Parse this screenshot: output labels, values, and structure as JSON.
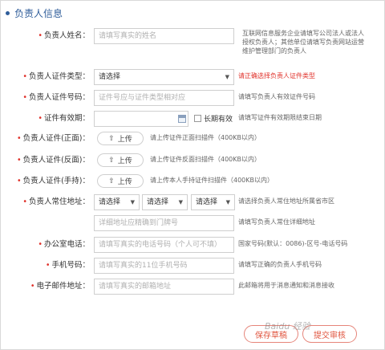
{
  "section": {
    "title": "负责人信息"
  },
  "fields": {
    "name": {
      "label": "负责人姓名：",
      "placeholder": "请填写真实的姓名",
      "hint": [
        "互联网信息服务企业请填写公司法人或法人",
        "授权负责人；其他单位请填写负责网站运营",
        "维护管理部门的负责人"
      ]
    },
    "id_type": {
      "label": "负责人证件类型：",
      "selected": "请选择",
      "hint": "请正确选择负责人证件类型"
    },
    "id_number": {
      "label": "负责人证件号码：",
      "placeholder": "证件号应与证件类型相对应",
      "hint": "请填写负责人有效证件号码"
    },
    "id_validity": {
      "label": "证件有效期：",
      "checkbox_label": "长期有效",
      "hint": "请填写证件有效期限结束日期"
    },
    "id_front": {
      "label": "负责人证件(正面)：",
      "button": "上传",
      "hint": "请上传证件正面扫描件（400KB以内）"
    },
    "id_back": {
      "label": "负责人证件(反面)：",
      "button": "上传",
      "hint": "请上传证件反面扫描件（400KB以内）"
    },
    "id_hand": {
      "label": "负责人证件(手持)：",
      "button": "上传",
      "hint": "请上传本人手持证件扫描件（400KB以内）"
    },
    "address": {
      "label": "负责人常住地址：",
      "select1": "请选择",
      "select2": "请选择",
      "select3": "请选择",
      "hint": "请选择负责人常住地址所属省市区",
      "detail_placeholder": "详细地址应精确到门牌号",
      "detail_hint": "请填写负责人常住详细地址"
    },
    "office_phone": {
      "label": "办公室电话：",
      "placeholder": "请填写真实的电话号码（个人可不填）",
      "hint": "国家号码(默认：0086)-区号-电话号码"
    },
    "mobile": {
      "label": "手机号码：",
      "placeholder": "请填写真实的11位手机号码",
      "hint": "请填写正确的负责人手机号码"
    },
    "email": {
      "label": "电子邮件地址：",
      "placeholder": "请填写真实的邮箱地址",
      "hint": "此邮箱将用于消息通知和消息接收"
    }
  },
  "required_mark": "•",
  "upload_icon": "upload-arrow-icon",
  "caret_icon": "▼",
  "actions": {
    "save": "保存草稿",
    "submit": "提交审核"
  },
  "watermark": "Baidu 经验",
  "colors": {
    "accent": "#2f5d9a",
    "required": "#e0322b",
    "button": "#e0553f"
  }
}
